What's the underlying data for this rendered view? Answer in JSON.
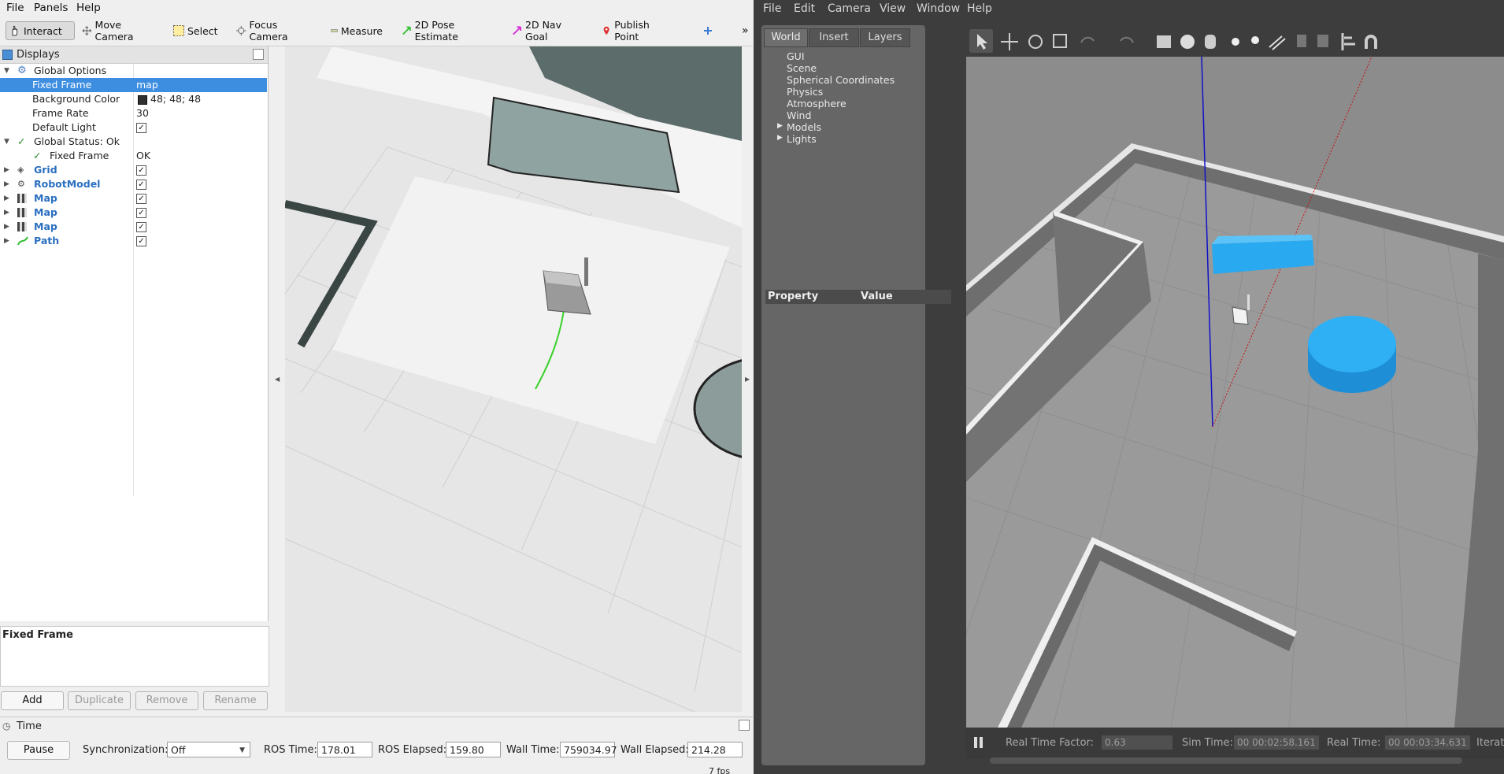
{
  "rviz": {
    "menu": [
      "File",
      "Panels",
      "Help"
    ],
    "toolbar": {
      "interact": "Interact",
      "move_camera": "Move Camera",
      "select": "Select",
      "focus_camera": "Focus Camera",
      "measure": "Measure",
      "pose_estimate": "2D Pose Estimate",
      "nav_goal": "2D Nav Goal",
      "publish_point": "Publish Point",
      "overflow": "»"
    },
    "displays": {
      "title": "Displays",
      "global_options": "Global Options",
      "fixed_frame_label": "Fixed Frame",
      "fixed_frame_value": "map",
      "background_color_label": "Background Color",
      "background_color_value": "48; 48; 48",
      "background_color_swatch": "#303030",
      "frame_rate_label": "Frame Rate",
      "frame_rate_value": "30",
      "default_light_label": "Default Light",
      "global_status": "Global Status: Ok",
      "status_fixed_frame": "Fixed Frame",
      "status_fixed_frame_value": "OK",
      "items": [
        "Grid",
        "RobotModel",
        "Map",
        "Map",
        "Map",
        "Path"
      ]
    },
    "description_title": "Fixed Frame",
    "buttons": {
      "add": "Add",
      "duplicate": "Duplicate",
      "remove": "Remove",
      "rename": "Rename"
    },
    "time": {
      "title": "Time",
      "pause": "Pause",
      "sync_label": "Synchronization:",
      "sync_value": "Off",
      "ros_time_label": "ROS Time:",
      "ros_time": "178.01",
      "ros_elapsed_label": "ROS Elapsed:",
      "ros_elapsed": "159.80",
      "wall_time_label": "Wall Time:",
      "wall_time": "759034.97",
      "wall_elapsed_label": "Wall Elapsed:",
      "wall_elapsed": "214.28",
      "fps": "7 fps"
    }
  },
  "gazebo": {
    "menu": [
      "File",
      "Edit",
      "Camera",
      "View",
      "Window",
      "Help"
    ],
    "tabs": [
      "World",
      "Insert",
      "Layers"
    ],
    "world_items": [
      "GUI",
      "Scene",
      "Spherical Coordinates",
      "Physics",
      "Atmosphere",
      "Wind",
      "Models",
      "Lights"
    ],
    "property_header": "Property",
    "value_header": "Value",
    "status": {
      "rtf_label": "Real Time Factor:",
      "rtf": "0.63",
      "sim_time_label": "Sim Time:",
      "sim_time": "00 00:02:58.161",
      "real_time_label": "Real Time:",
      "real_time": "00 00:03:34.631",
      "iterations_label": "Iterati"
    }
  },
  "colors": {
    "selection": "#3d8ee0",
    "display_name_blue": "#2a6fc0",
    "gazebo_object_blue": "#29a9f0",
    "path_green": "#39d12a"
  }
}
